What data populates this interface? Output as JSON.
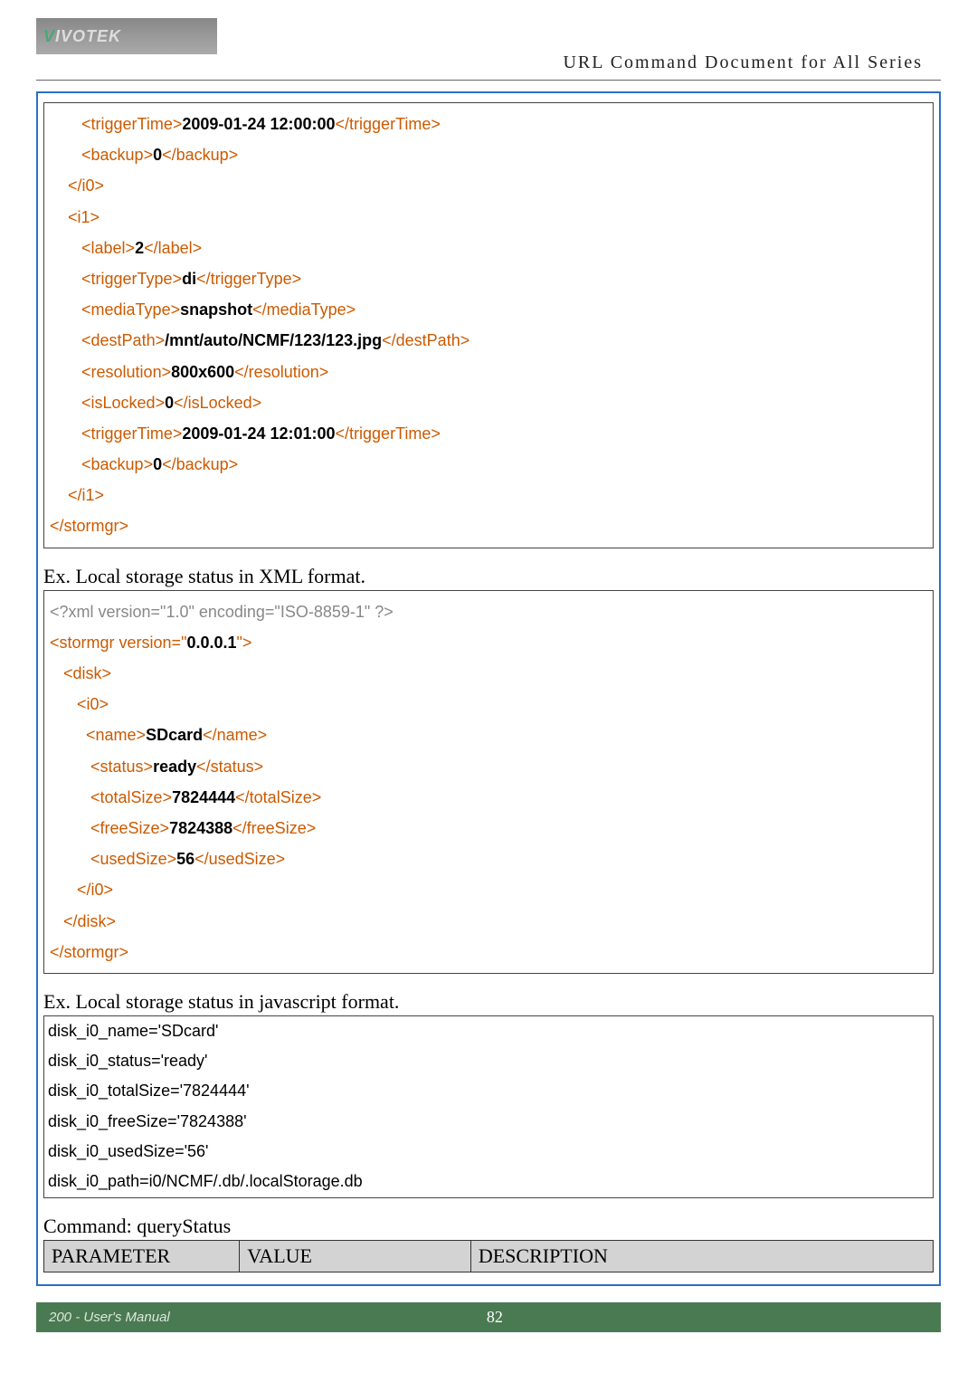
{
  "header": {
    "logo_v": "V",
    "logo_rest": "IVOTEK",
    "doc_title": "URL Command Document for All Series"
  },
  "box1": {
    "lines": [
      {
        "segs": [
          {
            "c": "txt",
            "t": "       "
          },
          {
            "c": "tag",
            "t": "<triggerTime>"
          },
          {
            "c": "bold",
            "t": "2009-01-24 12:00:00"
          },
          {
            "c": "tag",
            "t": "</triggerTime>"
          }
        ]
      },
      {
        "segs": [
          {
            "c": "txt",
            "t": "       "
          },
          {
            "c": "tag",
            "t": "<backup>"
          },
          {
            "c": "bold",
            "t": "0"
          },
          {
            "c": "tag",
            "t": "</backup>"
          }
        ]
      },
      {
        "segs": [
          {
            "c": "txt",
            "t": "    "
          },
          {
            "c": "tag",
            "t": "</i0>"
          }
        ]
      },
      {
        "segs": [
          {
            "c": "txt",
            "t": "    "
          },
          {
            "c": "tag",
            "t": "<i1>"
          }
        ]
      },
      {
        "segs": [
          {
            "c": "txt",
            "t": "       "
          },
          {
            "c": "tag",
            "t": "<label>"
          },
          {
            "c": "bold",
            "t": "2"
          },
          {
            "c": "tag",
            "t": "</label>"
          }
        ]
      },
      {
        "segs": [
          {
            "c": "txt",
            "t": "       "
          },
          {
            "c": "tag",
            "t": "<triggerType>"
          },
          {
            "c": "bold",
            "t": "di"
          },
          {
            "c": "tag",
            "t": "</triggerType>"
          }
        ]
      },
      {
        "segs": [
          {
            "c": "txt",
            "t": "       "
          },
          {
            "c": "tag",
            "t": "<mediaType>"
          },
          {
            "c": "bold",
            "t": "snapshot"
          },
          {
            "c": "tag",
            "t": "</mediaType>"
          }
        ]
      },
      {
        "segs": [
          {
            "c": "txt",
            "t": "       "
          },
          {
            "c": "tag",
            "t": "<destPath>"
          },
          {
            "c": "bold",
            "t": "/mnt/auto/NCMF/123/123.jpg"
          },
          {
            "c": "tag",
            "t": "</destPath>"
          }
        ]
      },
      {
        "segs": [
          {
            "c": "txt",
            "t": "       "
          },
          {
            "c": "tag",
            "t": "<resolution>"
          },
          {
            "c": "bold",
            "t": "800x600"
          },
          {
            "c": "tag",
            "t": "</resolution>"
          }
        ]
      },
      {
        "segs": [
          {
            "c": "txt",
            "t": "       "
          },
          {
            "c": "tag",
            "t": "<isLocked>"
          },
          {
            "c": "bold",
            "t": "0"
          },
          {
            "c": "tag",
            "t": "</isLocked>"
          }
        ]
      },
      {
        "segs": [
          {
            "c": "txt",
            "t": "       "
          },
          {
            "c": "tag",
            "t": "<triggerTime>"
          },
          {
            "c": "bold",
            "t": "2009-01-24 12:01:00"
          },
          {
            "c": "tag",
            "t": "</triggerTime>"
          }
        ]
      },
      {
        "segs": [
          {
            "c": "txt",
            "t": "       "
          },
          {
            "c": "tag",
            "t": "<backup>"
          },
          {
            "c": "bold",
            "t": "0"
          },
          {
            "c": "tag",
            "t": "</backup>"
          }
        ]
      },
      {
        "segs": [
          {
            "c": "txt",
            "t": "    "
          },
          {
            "c": "tag",
            "t": "</i1>"
          }
        ]
      },
      {
        "segs": [
          {
            "c": "tag",
            "t": "</stormgr>"
          }
        ]
      }
    ]
  },
  "caption1": "Ex. Local storage status in XML format.",
  "box2": {
    "lines": [
      {
        "segs": [
          {
            "c": "gray",
            "t": "<?xml version=\"1.0\" encoding=\"ISO-8859-1\" ?>"
          }
        ]
      },
      {
        "segs": [
          {
            "c": "tag",
            "t": "<stormgr"
          },
          {
            "c": "tag",
            "t": " version=\""
          },
          {
            "c": "str",
            "t": "0.0.0.1"
          },
          {
            "c": "tag",
            "t": "\">"
          }
        ]
      },
      {
        "segs": [
          {
            "c": "txt",
            "t": "   "
          },
          {
            "c": "tag",
            "t": "<disk>"
          }
        ]
      },
      {
        "segs": [
          {
            "c": "txt",
            "t": "      "
          },
          {
            "c": "tag",
            "t": "<i0>"
          }
        ]
      },
      {
        "segs": [
          {
            "c": "txt",
            "t": "        "
          },
          {
            "c": "tag",
            "t": "<name>"
          },
          {
            "c": "bold",
            "t": "SDcard"
          },
          {
            "c": "tag",
            "t": "</name>"
          }
        ]
      },
      {
        "segs": [
          {
            "c": "txt",
            "t": "         "
          },
          {
            "c": "tag",
            "t": "<status>"
          },
          {
            "c": "bold",
            "t": "ready"
          },
          {
            "c": "tag",
            "t": "</status>"
          }
        ]
      },
      {
        "segs": [
          {
            "c": "txt",
            "t": "         "
          },
          {
            "c": "tag",
            "t": "<totalSize>"
          },
          {
            "c": "bold",
            "t": "7824444"
          },
          {
            "c": "tag",
            "t": "</totalSize>"
          }
        ]
      },
      {
        "segs": [
          {
            "c": "txt",
            "t": "         "
          },
          {
            "c": "tag",
            "t": "<freeSize>"
          },
          {
            "c": "bold",
            "t": "7824388"
          },
          {
            "c": "tag",
            "t": "</freeSize>"
          }
        ]
      },
      {
        "segs": [
          {
            "c": "txt",
            "t": "         "
          },
          {
            "c": "tag",
            "t": "<usedSize>"
          },
          {
            "c": "bold",
            "t": "56"
          },
          {
            "c": "tag",
            "t": "</usedSize>"
          }
        ]
      },
      {
        "segs": [
          {
            "c": "txt",
            "t": "      "
          },
          {
            "c": "tag",
            "t": "</i0>"
          }
        ]
      },
      {
        "segs": [
          {
            "c": "txt",
            "t": "   "
          },
          {
            "c": "tag",
            "t": "</disk>"
          }
        ]
      },
      {
        "segs": [
          {
            "c": "tag",
            "t": "</stormgr>"
          }
        ]
      }
    ]
  },
  "caption2": "Ex. Local storage status in javascript format.",
  "box3": {
    "lines": [
      "disk_i0_name='SDcard'",
      "disk_i0_status='ready'",
      "disk_i0_totalSize='7824444'",
      "disk_i0_freeSize='7824388'",
      "disk_i0_usedSize='56'",
      "disk_i0_path=i0/NCMF/.db/.localStorage.db"
    ]
  },
  "command_label": "Command: queryStatus",
  "table": {
    "h1": "PARAMETER",
    "h2": "VALUE",
    "h3": "DESCRIPTION"
  },
  "footer": {
    "left": "200 - User's Manual",
    "page": "82"
  }
}
